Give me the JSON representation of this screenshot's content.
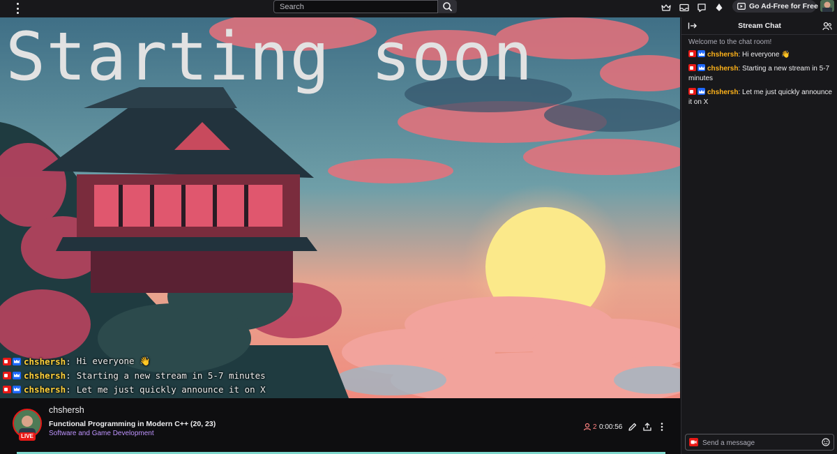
{
  "topbar": {
    "search_placeholder": "Search",
    "ad_free_label": "Go Ad-Free for Free"
  },
  "video": {
    "title": "Starting soon",
    "overlay_chat": [
      {
        "user": "chshersh",
        "message": "Hi everyone 👋"
      },
      {
        "user": "chshersh",
        "message": "Starting a new stream in 5-7 minutes"
      },
      {
        "user": "chshersh",
        "message": "Let me just quickly announce it on X"
      }
    ]
  },
  "stream": {
    "streamer": "chshersh",
    "live_label": "LIVE",
    "title": "Functional Programming in Modern C++ (20, 23)",
    "category": "Software and Game Development",
    "viewers": "2",
    "uptime": "0:00:56"
  },
  "chat": {
    "title": "Stream Chat",
    "welcome": "Welcome to the chat room!",
    "messages": [
      {
        "user": "chshersh",
        "text": "Hi everyone 👋"
      },
      {
        "user": "chshersh",
        "text": "Starting a new stream in 5-7 minutes"
      },
      {
        "user": "chshersh",
        "text": "Let me just quickly announce it on X"
      }
    ],
    "input_placeholder": "Send a message"
  },
  "colors": {
    "live_red": "#e91916",
    "username_yellow": "#ffb31a",
    "category_purple": "#bf94ff",
    "topbar_bg": "#18181b"
  },
  "icons": [
    "kebab-menu-icon",
    "search-icon",
    "crown-icon",
    "inbox-icon",
    "whispers-icon",
    "bits-icon",
    "ad-free-icon",
    "collapse-chat-icon",
    "users-icon",
    "viewers-icon",
    "edit-icon",
    "share-icon",
    "more-options-icon",
    "camera-icon",
    "emote-icon"
  ]
}
